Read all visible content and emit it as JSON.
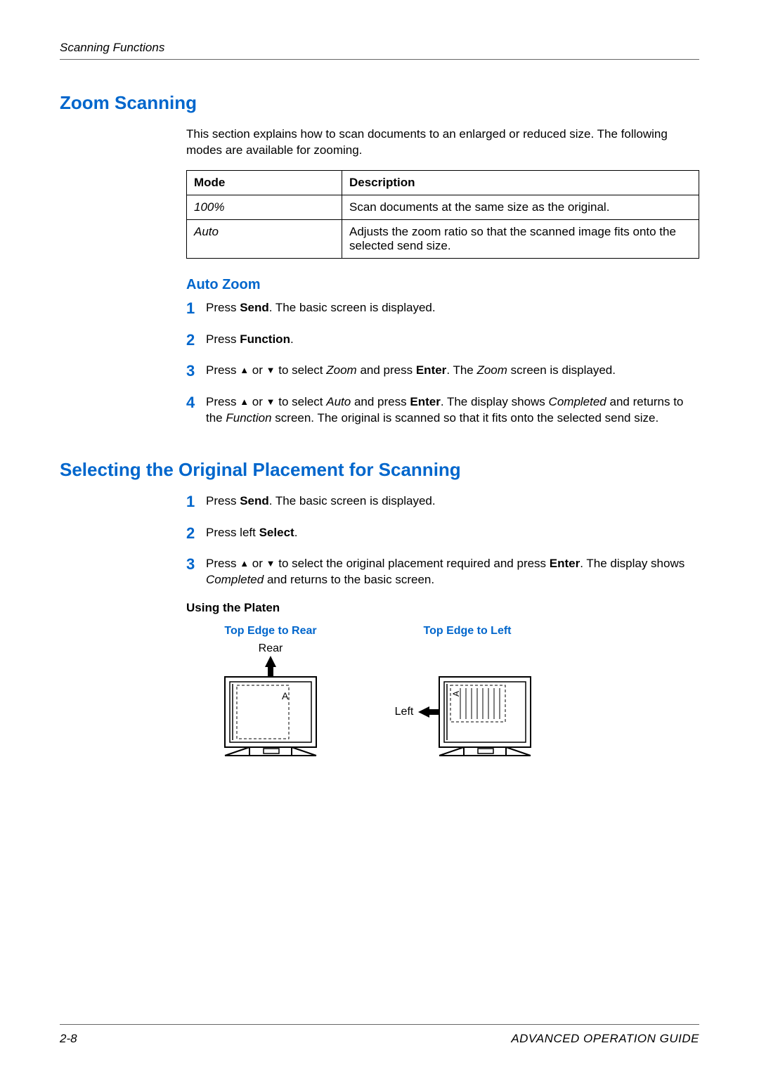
{
  "header": "Scanning Functions",
  "section1": {
    "title": "Zoom Scanning",
    "intro": "This section explains how to scan documents to an enlarged or reduced size. The following modes are available for zooming.",
    "table": {
      "head": {
        "c0": "Mode",
        "c1": "Description"
      },
      "rows": [
        {
          "mode": "100%",
          "desc": "Scan documents at the same size as the original."
        },
        {
          "mode": "Auto",
          "desc": "Adjusts the zoom ratio so that the scanned image fits onto the selected send size."
        }
      ]
    },
    "sub": {
      "title": "Auto Zoom",
      "steps": {
        "s1": {
          "n": "1",
          "pre": "Press ",
          "b1": "Send",
          "post": ". The basic screen is displayed."
        },
        "s2": {
          "n": "2",
          "pre": "Press ",
          "b1": "Function",
          "post": "."
        },
        "s3": {
          "n": "3",
          "pre": "Press ",
          "up": "▲",
          "mid1": " or ",
          "down": "▼",
          "mid2": " to select ",
          "i1": "Zoom",
          "mid3": " and press ",
          "b1": "Enter",
          "mid4": ". The ",
          "i2": "Zoom",
          "post": " screen is displayed."
        },
        "s4": {
          "n": "4",
          "pre": "Press ",
          "up": "▲",
          "mid1": " or ",
          "down": "▼",
          "mid2": " to select ",
          "i1": "Auto",
          "mid3": " and press ",
          "b1": "Enter",
          "mid4": ". The display shows ",
          "i2": "Completed",
          "mid5": " and returns to the ",
          "i3": "Function",
          "post": " screen. The original is scanned so that it fits onto the selected send size."
        }
      }
    }
  },
  "section2": {
    "title": "Selecting the Original Placement for Scanning",
    "steps": {
      "s1": {
        "n": "1",
        "pre": "Press ",
        "b1": "Send",
        "post": ". The basic screen is displayed."
      },
      "s2": {
        "n": "2",
        "pre": "Press left ",
        "b1": "Select",
        "post": "."
      },
      "s3": {
        "n": "3",
        "pre": "Press ",
        "up": "▲",
        "mid1": " or ",
        "down": "▼",
        "mid2": " to select the original placement required and press ",
        "b1": "Enter",
        "mid3": ". The display shows ",
        "i1": "Completed",
        "post": " and returns to the basic screen."
      }
    },
    "platen_title": "Using the Platen",
    "diagrams": {
      "d1": {
        "title": "Top Edge to Rear",
        "label": "Rear"
      },
      "d2": {
        "title": "Top Edge to Left",
        "label": "Left"
      }
    }
  },
  "footer": {
    "page": "2-8",
    "guide": "ADVANCED OPERATION GUIDE"
  }
}
